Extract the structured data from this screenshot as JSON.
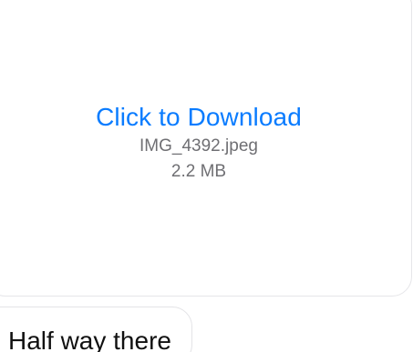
{
  "attachment": {
    "download_label": "Click to Download",
    "file_name": "IMG_4392.jpeg",
    "file_size": "2.2 MB"
  },
  "message": {
    "text": "Half way there"
  },
  "colors": {
    "link": "#0a7cff",
    "secondary_text": "#6f6f73",
    "primary_text": "#111111",
    "bubble_border": "#e6e6e9"
  }
}
